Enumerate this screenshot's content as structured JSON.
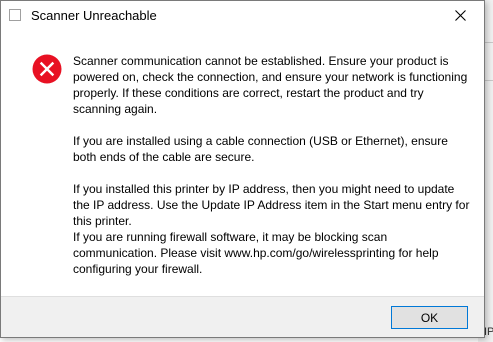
{
  "window": {
    "title": "Scanner Unreachable",
    "icons": {
      "app": "blank-window-icon",
      "close": "close-icon",
      "status": "error-icon"
    }
  },
  "message": {
    "p1": "Scanner communication cannot be established.  Ensure your product is powered on, check the connection, and ensure your network is functioning properly.  If these conditions are correct, restart the product and try scanning again.",
    "p2": "If you are installed using a cable connection (USB or Ethernet), ensure both ends of the cable are secure.",
    "p3": "If you installed this printer by IP address, then you might need to update the IP address.  Use the Update IP Address item in the Start menu entry for this printer.",
    "p4": "If you are running firewall software, it may be blocking scan communication.  Please visit www.hp.com/go/wirelessprinting for help configuring your firewall."
  },
  "buttons": {
    "ok": "OK"
  },
  "colors": {
    "error": "#e81123",
    "focus": "#0078d7",
    "footer": "#f0f0f0"
  },
  "background": {
    "partial_text": "IP"
  }
}
